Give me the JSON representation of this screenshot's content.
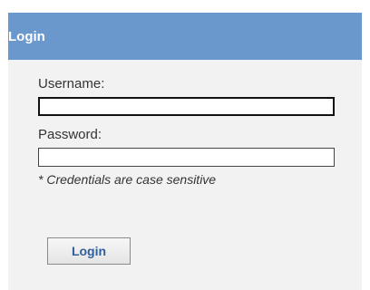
{
  "panel": {
    "title": "Login"
  },
  "form": {
    "username_label": "Username:",
    "username_value": "",
    "password_label": "Password:",
    "password_value": "",
    "hint": "* Credentials are case sensitive",
    "submit_label": "Login"
  },
  "colors": {
    "header_bg": "#6a97cc",
    "panel_bg": "#f2f2f2",
    "button_text": "#2f5f9a"
  }
}
